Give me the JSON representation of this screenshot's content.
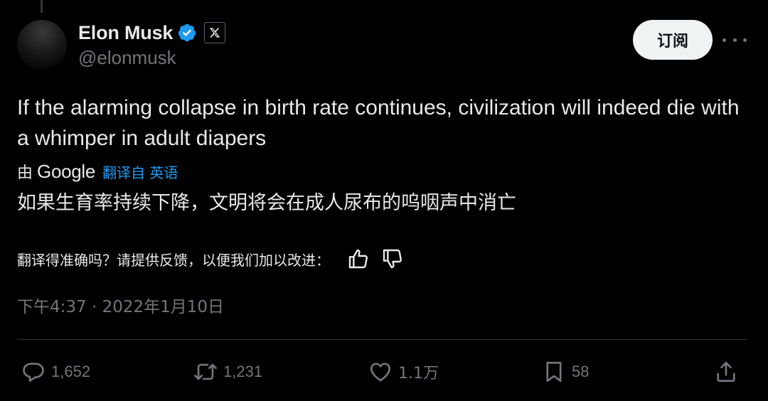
{
  "tweet": {
    "display_name": "Elon Musk",
    "handle": "@elonmusk",
    "subscribe_label": "订阅",
    "text": "If the alarming collapse in birth rate continues, civilization will indeed die with a whimper in adult diapers",
    "translation": {
      "by_label": "由",
      "provider": "Google",
      "translated_from": "翻译自 英语",
      "text": "如果生育率持续下降，文明将会在成人尿布的呜咽声中消亡",
      "feedback_prompt": "翻译得准确吗？请提供反馈，以便我们加以改进："
    },
    "timestamp": "下午4:37 · 2022年1月10日",
    "metrics": {
      "replies": "1,652",
      "reposts": "1,231",
      "likes": "1.1万",
      "bookmarks": "58"
    }
  },
  "icons": {
    "verified": "verified-badge-icon",
    "platform": "x-logo-icon",
    "more": "more-icon",
    "thumbs_up": "thumbs-up-icon",
    "thumbs_down": "thumbs-down-icon",
    "reply": "reply-icon",
    "repost": "repost-icon",
    "like": "like-icon",
    "bookmark": "bookmark-icon",
    "share": "share-icon"
  },
  "colors": {
    "background": "#000000",
    "text_primary": "#e7e9ea",
    "text_secondary": "#71767b",
    "accent": "#1d9bf0",
    "button_bg": "#eff3f4",
    "button_text": "#0f1419",
    "divider": "#2f3336"
  }
}
